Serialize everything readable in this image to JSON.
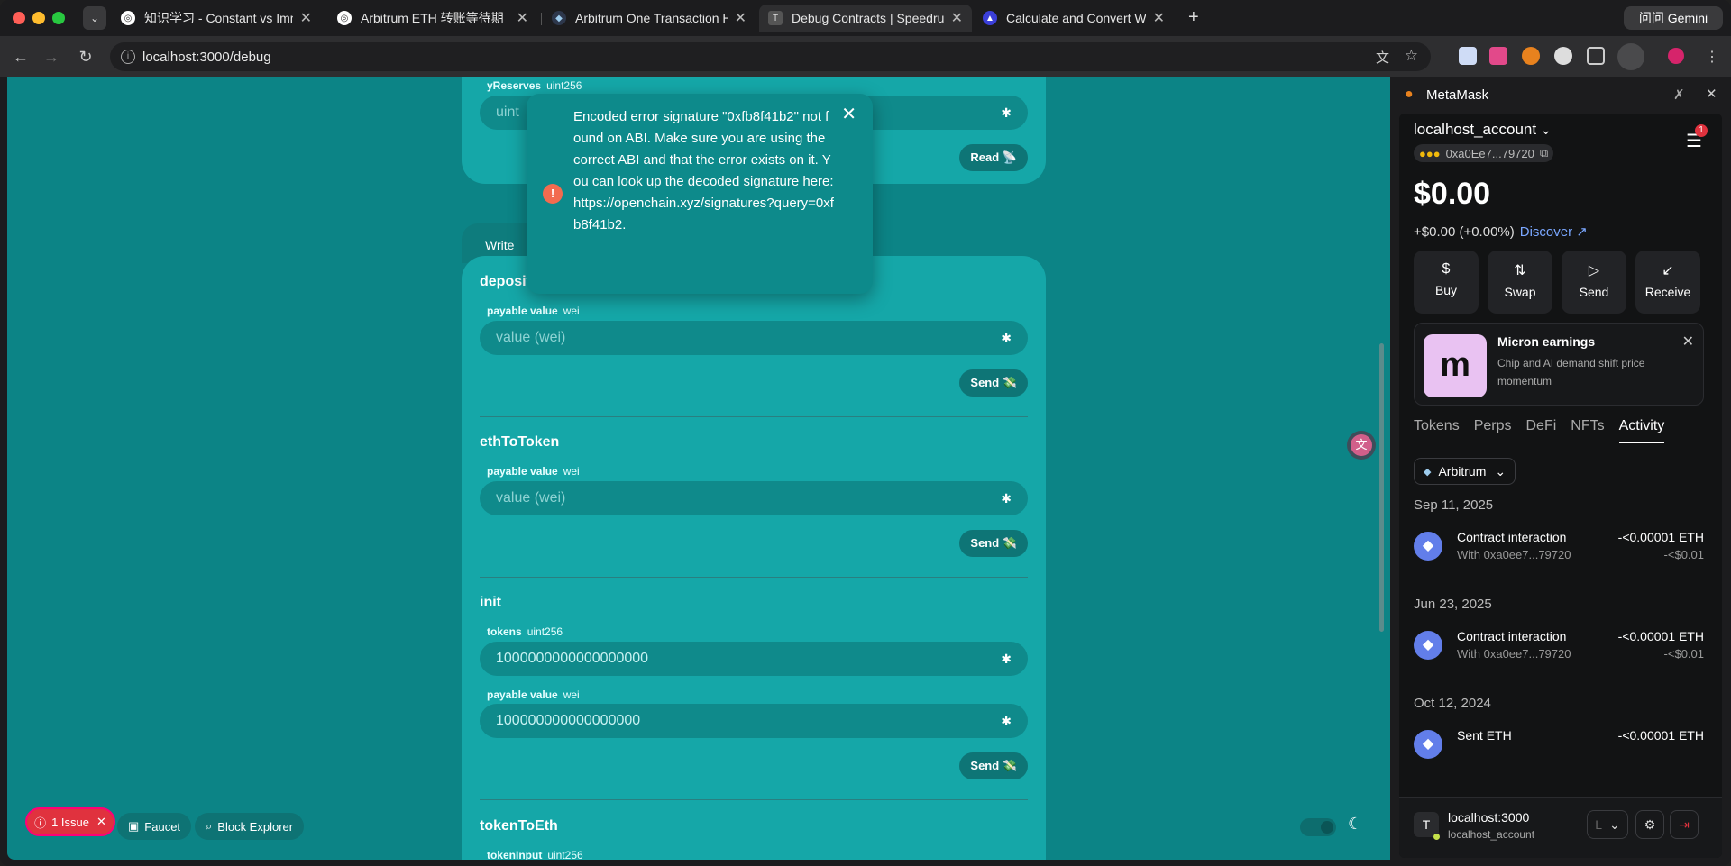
{
  "browser": {
    "tabs": [
      {
        "title": "知识学习 - Constant vs Immut"
      },
      {
        "title": "Arbitrum ETH 转账等待期"
      },
      {
        "title": "Arbitrum One Transaction Has"
      },
      {
        "title": "Debug Contracts | Speedrun E"
      },
      {
        "title": "Calculate and Convert Wei, G"
      }
    ],
    "new_tab_label": "+",
    "gemini_label": "问问 Gemini",
    "url": "localhost:3000/debug"
  },
  "page": {
    "top_card": {
      "param_label": "yReserves",
      "param_type": "uint256",
      "input_placeholder": "uint",
      "read_button": "Read 📡"
    },
    "write_tab": "Write",
    "functions": [
      {
        "name": "deposit",
        "param_label": "payable value",
        "param_type": "wei",
        "placeholder": "value (wei)",
        "button": "Send 💸"
      },
      {
        "name": "ethToToken",
        "param_label": "payable value",
        "param_type": "wei",
        "placeholder": "value (wei)",
        "button": "Send 💸"
      },
      {
        "name": "init",
        "param1_label": "tokens",
        "param1_type": "uint256",
        "param1_value": "1000000000000000000",
        "param2_label": "payable value",
        "param2_type": "wei",
        "param2_value": "100000000000000000",
        "button": "Send 💸"
      },
      {
        "name": "tokenToEth",
        "param_label": "tokenInput",
        "param_type": "uint256"
      }
    ],
    "toast": {
      "message": "Encoded error signature \"0xfb8f41b2\" not found on ABI. Make sure you are using the correct ABI and that the error exists on it. You can look up the decoded signature here: https://openchain.xyz/signatures?query=0xfb8f41b2."
    },
    "issue_label": "1 Issue",
    "faucet_label": "Faucet",
    "block_explorer_label": "Block Explorer"
  },
  "metamask": {
    "title": "MetaMask",
    "account": "localhost_account",
    "address": "0xa0Ee7...79720",
    "notification_count": "1",
    "balance": "$0.00",
    "change": "+$0.00 (+0.00%)",
    "discover": "Discover",
    "actions": [
      "Buy",
      "Swap",
      "Send",
      "Receive"
    ],
    "promo": {
      "title": "Micron earnings",
      "description": "Chip and AI demand shift price momentum"
    },
    "tabs": [
      "Tokens",
      "Perps",
      "DeFi",
      "NFTs",
      "Activity"
    ],
    "network": "Arbitrum",
    "activity": [
      {
        "date": "Sep 11, 2025",
        "title": "Contract interaction",
        "sub": "With 0xa0ee7...79720",
        "amount": "-<0.00001 ETH",
        "fiat": "-<$0.01"
      },
      {
        "date": "Jun 23, 2025",
        "title": "Contract interaction",
        "sub": "With 0xa0ee7...79720",
        "amount": "-<0.00001 ETH",
        "fiat": "-<$0.01"
      },
      {
        "date": "Oct 12, 2024",
        "title": "Sent ETH",
        "sub": "",
        "amount": "-<0.00001 ETH",
        "fiat": ""
      }
    ],
    "footer": {
      "host": "localhost:3000",
      "account": "localhost_account",
      "select_label": "L"
    }
  }
}
